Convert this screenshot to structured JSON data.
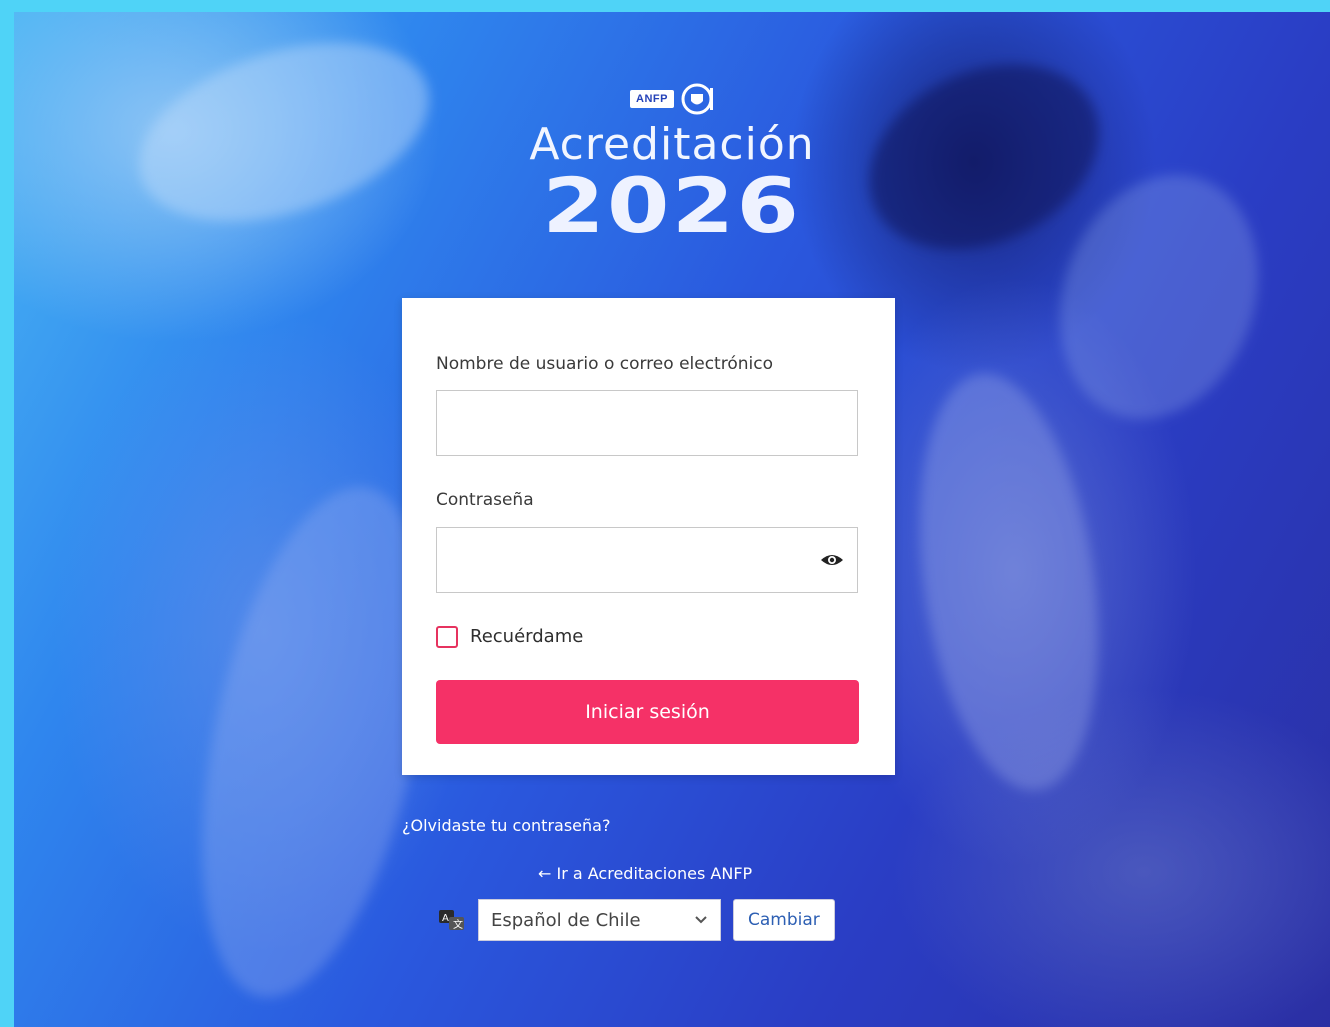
{
  "brand": {
    "federation": "ANFP",
    "title": "Acreditación",
    "year": "2026"
  },
  "login_form": {
    "username_label": "Nombre de usuario o correo electrónico",
    "username_value": "",
    "password_label": "Contraseña",
    "password_value": "",
    "password_toggle_icon": "eye-icon",
    "remember_label": "Recuérdame",
    "remember_checked": false,
    "submit_label": "Iniciar sesión"
  },
  "links": {
    "forgot_password": "¿Olvidaste tu contraseña?",
    "back_link": "← Ir a Acreditaciones ANFP"
  },
  "language": {
    "icon": "translate-icon",
    "selected": "Español de Chile",
    "change_label": "Cambiar"
  },
  "colors": {
    "accent": "#f53167",
    "checkbox_border": "#e6335f",
    "link_button_text": "#2d5fb3"
  }
}
